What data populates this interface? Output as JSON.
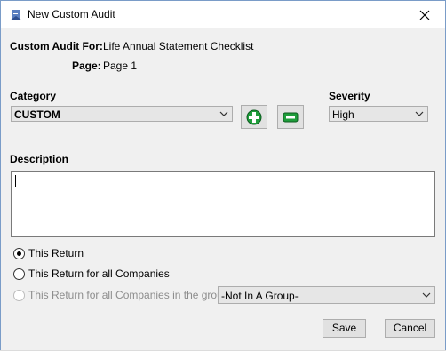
{
  "window": {
    "title": "New Custom Audit"
  },
  "header": {
    "custom_audit_for_label": "Custom Audit For:",
    "custom_audit_for_value": "Life Annual Statement Checklist",
    "page_label": "Page:",
    "page_value": "Page 1"
  },
  "category": {
    "label": "Category",
    "value": "CUSTOM"
  },
  "severity": {
    "label": "Severity",
    "value": "High"
  },
  "description": {
    "label": "Description",
    "value": ""
  },
  "scope": {
    "options": [
      {
        "label": "This Return",
        "checked": true,
        "enabled": true
      },
      {
        "label": "This Return for all Companies",
        "checked": false,
        "enabled": true
      },
      {
        "label": "This Return for all Companies in the group:",
        "checked": false,
        "enabled": false
      }
    ],
    "group_value": "-Not In A Group-"
  },
  "buttons": {
    "save": "Save",
    "cancel": "Cancel"
  },
  "colors": {
    "add_icon": "#1e9c3a",
    "remove_icon": "#1e9c3a",
    "window_border": "#7a9cc8"
  }
}
